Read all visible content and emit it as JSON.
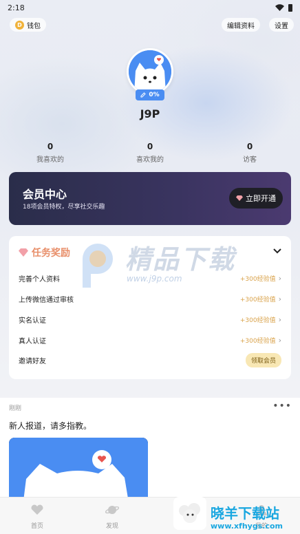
{
  "status_bar": {
    "time": "2:18"
  },
  "header": {
    "wallet_label": "钱包",
    "coin_letter": "D",
    "edit_profile_label": "编辑资料",
    "settings_label": "设置"
  },
  "profile": {
    "completion": "0%",
    "username": "J9P"
  },
  "stats": [
    {
      "value": "0",
      "label": "我喜欢的"
    },
    {
      "value": "0",
      "label": "喜欢我的"
    },
    {
      "value": "0",
      "label": "访客"
    }
  ],
  "vip": {
    "title": "会员中心",
    "subtitle": "18项会员特权，尽享社交乐趣",
    "button_label": "立即开通"
  },
  "tasks": {
    "title": "任务奖励",
    "items": [
      {
        "name": "完善个人资料",
        "reward": "+300经验值"
      },
      {
        "name": "上传微信通过审核",
        "reward": "+300经验值"
      },
      {
        "name": "实名认证",
        "reward": "+300经验值"
      },
      {
        "name": "真人认证",
        "reward": "+300经验值"
      },
      {
        "name": "邀请好友",
        "reward": "领取会员"
      }
    ]
  },
  "watermark": {
    "title": "精品下载",
    "url": "www.j9p.com"
  },
  "feed": {
    "time": "刚刚",
    "more": "•••",
    "text": "新人报道，请多指教。"
  },
  "tabbar": [
    {
      "label": "首页",
      "icon": "heart-icon"
    },
    {
      "label": "发现",
      "icon": "planet-icon"
    },
    {
      "label": "我的",
      "icon": "user-icon"
    }
  ],
  "brand": {
    "title": "晓羊下载站",
    "url": "www.xfhygs.com"
  },
  "colors": {
    "accent": "#4a8df2",
    "vip_bg": "#2f2f52",
    "task_title": "#e88f6a",
    "reward": "#d9a24a"
  }
}
